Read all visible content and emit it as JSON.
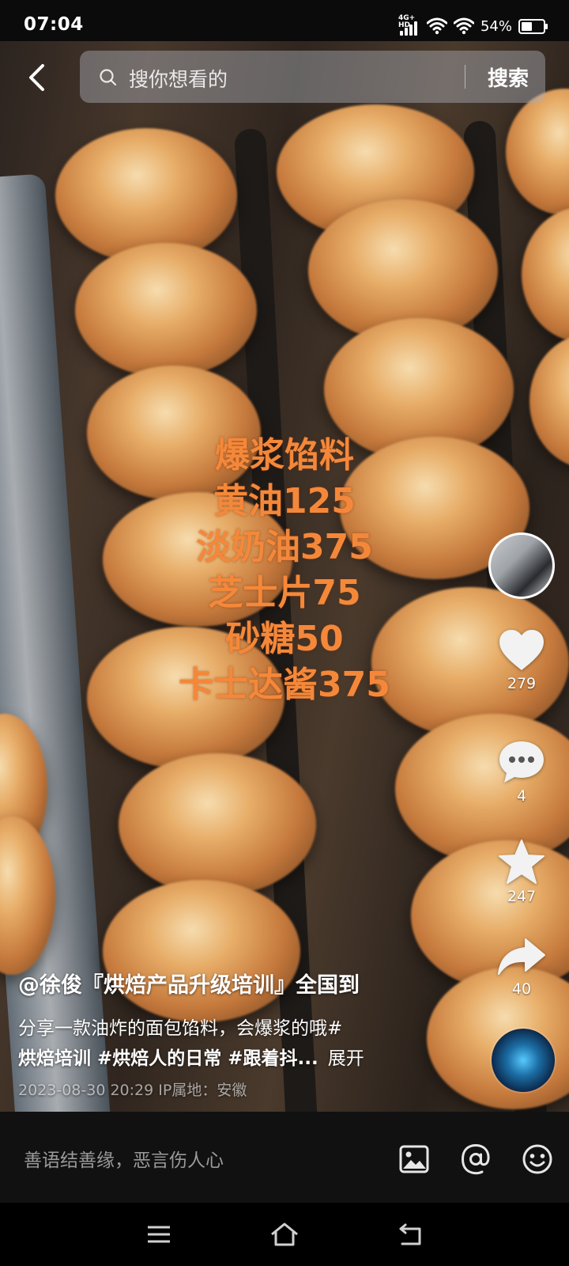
{
  "status_bar": {
    "time": "07:04",
    "network_label": "4G+ HD",
    "battery_percent": "54%",
    "battery_level": 0.54
  },
  "search": {
    "back_icon": "chevron-left-icon",
    "placeholder": "搜你想看的",
    "button_label": "搜索"
  },
  "video": {
    "overlay_lines": [
      "爆浆馅料",
      "黄油125",
      "淡奶油375",
      "芝士片75",
      "砂糖50",
      "卡士达酱375"
    ]
  },
  "actions": {
    "like_count": "279",
    "comment_count": "4",
    "favorite_count": "247",
    "share_count": "40"
  },
  "caption": {
    "author_title": "@徐俊『烘焙产品升级培训』全国到",
    "description_line1": "分享一款油炸的面包馅料，会爆浆的哦#",
    "description_line2": "烘焙培训 #烘焙人的日常 #跟着抖...",
    "expand_label": "展开",
    "meta": "2023-08-30 20:29  IP属地：安徽"
  },
  "comment_bar": {
    "placeholder": "善语结善缘，恶言伤人心",
    "icons": [
      "image-icon",
      "at-icon",
      "emoji-icon"
    ]
  },
  "nav_bar": {
    "icons": [
      "menu-icon",
      "home-icon",
      "back-icon"
    ]
  },
  "colors": {
    "overlay_text": "#f4883a",
    "background": "#000000"
  }
}
